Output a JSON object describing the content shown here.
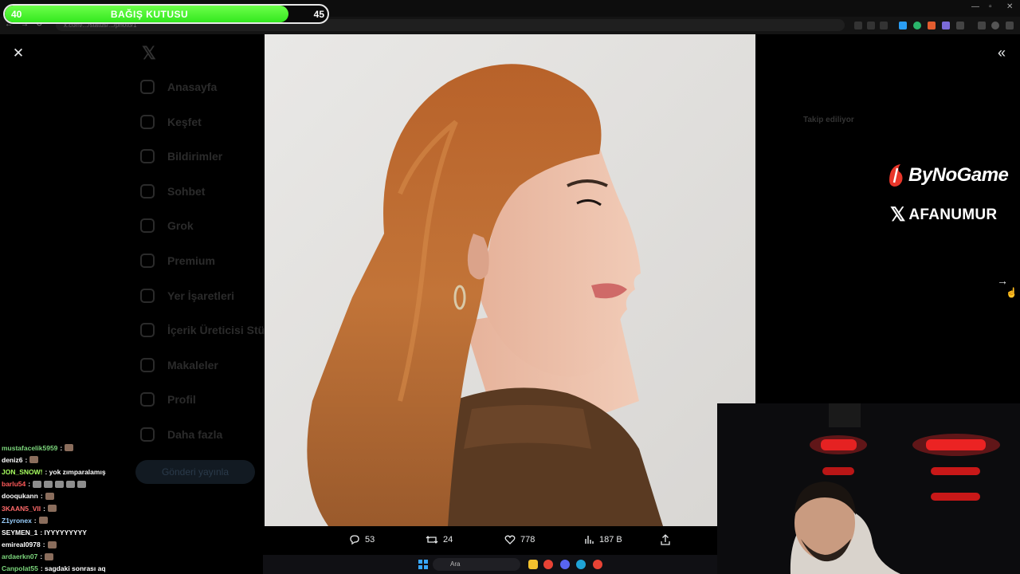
{
  "donation": {
    "start": "40",
    "label": "BAĞIŞ KUTUSU",
    "goal": "45",
    "progress": 0.88
  },
  "browser": {
    "url": "x.com/.../status/.../photo/1"
  },
  "sidebar": {
    "items": [
      "Anasayfa",
      "Keşfet",
      "Bildirimler",
      "Sohbet",
      "Grok",
      "Premium",
      "Yer İşaretleri",
      "İçerik Üreticisi Stü",
      "Makaleler",
      "Profil",
      "Daha fazla"
    ],
    "post_label": "Gönderi yayınla"
  },
  "backdrop": {
    "right_title": "Takip ediliyor"
  },
  "actions": {
    "replies": "53",
    "reposts": "24",
    "likes": "778",
    "views": "187 B"
  },
  "brands": {
    "bynogame": "ByNoGame",
    "afanumur": "AFANUMUR"
  },
  "chat": [
    {
      "user": "mustafacelik5959",
      "text": ":",
      "color": "#7cd67c",
      "emotes": 1
    },
    {
      "user": "deniz6",
      "text": ":",
      "color": "#ffffff",
      "emotes": 1
    },
    {
      "user": "JON_SNOW!",
      "text": ": yok zımparalamış",
      "color": "#a8ff60",
      "emotes": 0
    },
    {
      "user": "barlu54",
      "text": ":",
      "color": "#ff5a5a",
      "emotes": 5
    },
    {
      "user": "dooqukann",
      "text": ":",
      "color": "#ffffff",
      "emotes": 1
    },
    {
      "user": "3KAAN5_VII",
      "text": ":",
      "color": "#ff6a6a",
      "emotes": 1
    },
    {
      "user": "Z1yronex",
      "text": ":",
      "color": "#9ad0ff",
      "emotes": 1
    },
    {
      "user": "SEYMEN_1",
      "text": ": IYYYYYYYYY",
      "color": "#ffffff",
      "emotes": 0
    },
    {
      "user": "emireal0978",
      "text": ":",
      "color": "#ffffff",
      "emotes": 1
    },
    {
      "user": "ardaerkn07",
      "text": ":",
      "color": "#7cd67c",
      "emotes": 1
    },
    {
      "user": "Canpolat55",
      "text": ": sagdaki sonrası aq",
      "color": "#7cd67c",
      "emotes": 0
    }
  ],
  "taskbar": {
    "search": "Ara"
  },
  "colors": {
    "accent_green": "#33e81f",
    "x_blue": "#1d9bf0",
    "bynogame_red": "#e8362a"
  }
}
